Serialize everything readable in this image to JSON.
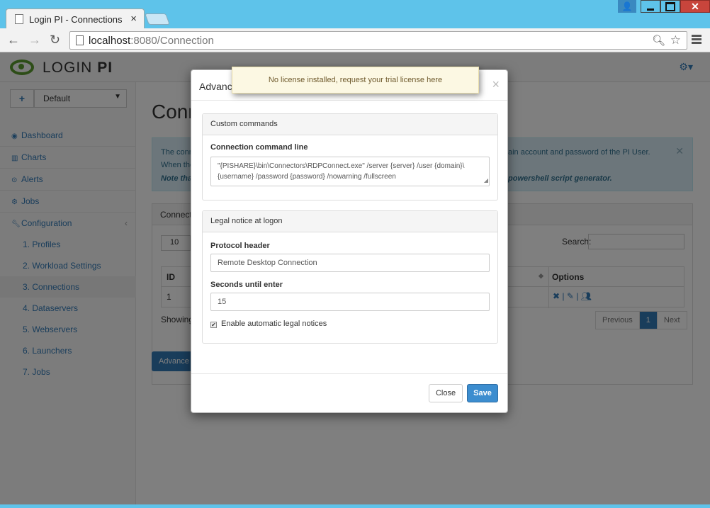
{
  "browser": {
    "tab_title": "Login PI - Connections",
    "url_host": "localhost",
    "url_path": ":8080/Connection"
  },
  "app": {
    "logo_text_light": "LOGIN ",
    "logo_text_bold": "PI",
    "profile_select": "Default",
    "sidebar": {
      "items": [
        {
          "label": "Dashboard",
          "icon": "dashboard-icon"
        },
        {
          "label": "Charts",
          "icon": "chart-icon"
        },
        {
          "label": "Alerts",
          "icon": "alert-icon"
        },
        {
          "label": "Jobs",
          "icon": "cogs-icon"
        },
        {
          "label": "Configuration",
          "icon": "wrench-icon"
        }
      ],
      "sub_items": [
        {
          "label": "1. Profiles"
        },
        {
          "label": "2. Workload Settings"
        },
        {
          "label": "3. Connections",
          "active": true
        },
        {
          "label": "4. Dataservers"
        },
        {
          "label": "5. Webservers"
        },
        {
          "label": "6. Launchers"
        },
        {
          "label": "7. Jobs"
        }
      ]
    },
    "content": {
      "title": "Conn",
      "alert_l1": "The conn",
      "alert_l2": "When the",
      "alert_l3": "Note tha",
      "alert_r1": "ain account and password of the PI User.",
      "alert_r3": "powershell script generator.",
      "panel_title": "Connecti",
      "length_value": "10",
      "search_label": "Search:",
      "col_id": "ID",
      "col_options": "Options",
      "row_id": "1",
      "showing": "Showing",
      "pager": {
        "prev": "Previous",
        "current": "1",
        "next": "Next"
      },
      "advanced_button": "Advance"
    }
  },
  "modal": {
    "title": "Advanc",
    "section1_title": "Custom commands",
    "cmd_label": "Connection command line",
    "cmd_value_line1": "\"{PISHARE}\\bin\\Connectors\\RDPConnect.exe\" /server {server} /user {domain}\\",
    "cmd_value_line2": "{username} /password {password} /nowarning /fullscreen",
    "section2_title": "Legal notice at logon",
    "protocol_label": "Protocol header",
    "protocol_value": "Remote Desktop Connection",
    "seconds_label": "Seconds until enter",
    "seconds_value": "15",
    "checkbox_label": "Enable automatic legal notices",
    "checkbox_checked": true,
    "close_button": "Close",
    "save_button": "Save"
  },
  "toast": {
    "text": "No license installed, request your trial license here"
  },
  "colors": {
    "accent": "#337ab7",
    "save_button": "#3c8dcf",
    "toast_bg": "#fcf8e3",
    "titlebar": "#5ec3ea"
  }
}
